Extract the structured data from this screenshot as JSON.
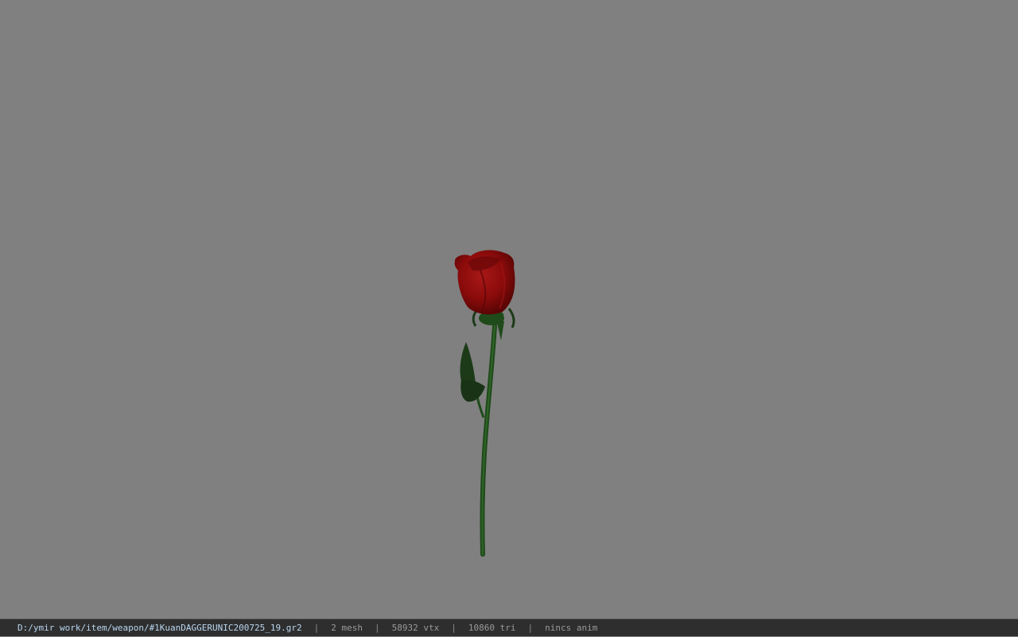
{
  "viewer": {
    "background_color": "#808080",
    "model": {
      "name": "rose",
      "bloom_color": "#8b0b0b",
      "stem_color": "#1f4a1a",
      "leaf_color": "#1c3a18"
    }
  },
  "statusbar": {
    "file_path": "D:/ymir work/item/weapon/#1KuanDAGGERUNIC200725_19.gr2",
    "separator": "|",
    "mesh": "2 mesh",
    "vtx": "58932 vtx",
    "tri": "10860 tri",
    "anim": "nincs anim"
  }
}
